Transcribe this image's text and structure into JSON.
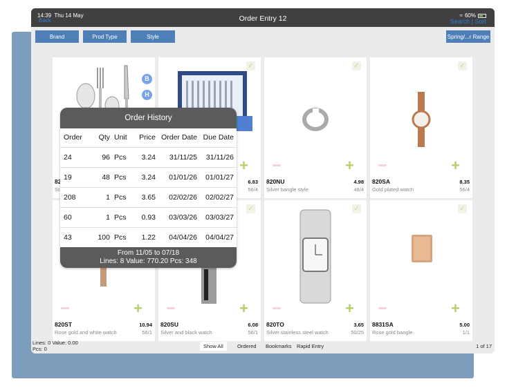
{
  "status": {
    "time": "14:39",
    "date": "Thu 14 May",
    "battery": "60%"
  },
  "nav": {
    "back": "Back",
    "title": "Order Entry 12",
    "search": "Search",
    "sort": "Sort",
    "separator": "|"
  },
  "filters": {
    "brand": "Brand",
    "prod_type": "Prod Type",
    "style": "Style",
    "range": "Spring/...r Range"
  },
  "products": [
    {
      "code": "82",
      "price": "",
      "desc": "St",
      "stock": "",
      "icon": "cutlery-image"
    },
    {
      "code": "",
      "price": "6.83",
      "desc": "",
      "stock": "56/4",
      "icon": "cutlery-box-image"
    },
    {
      "code": "820NU",
      "price": "4.98",
      "desc": "Silver bangle style",
      "stock": "48/4",
      "icon": "bangle-image"
    },
    {
      "code": "820SA",
      "price": "8.35",
      "desc": "Gold plated watch",
      "stock": "56/4",
      "icon": "gold-watch-image"
    },
    {
      "code": "820ST",
      "price": "10.94",
      "desc": "Rose gold and white watch",
      "stock": "56/1",
      "icon": "rose-watch-image"
    },
    {
      "code": "820SU",
      "price": "6.08",
      "desc": "Silver and black watch",
      "stock": "56/1",
      "icon": "black-watch-image"
    },
    {
      "code": "820TO",
      "price": "3.65",
      "desc": "Silver stainless steel watch",
      "stock": "50/25",
      "icon": "steel-watch-image"
    },
    {
      "code": "8831SA",
      "price": "5.00",
      "desc": "Rose gold bangle",
      "stock": "1/1",
      "icon": "rose-bangle-image"
    }
  ],
  "badges": {
    "b": "B",
    "h": "H"
  },
  "order_history": {
    "title": "Order History",
    "headers": [
      "Order",
      "Qty",
      "Unit",
      "Price",
      "Order Date",
      "Due Date"
    ],
    "rows": [
      [
        "24",
        "96",
        "Pcs",
        "3.24",
        "31/11/25",
        "31/11/26"
      ],
      [
        "19",
        "48",
        "Pcs",
        "3.24",
        "01/01/26",
        "01/01/27"
      ],
      [
        "208",
        "1",
        "Pcs",
        "3.65",
        "02/02/26",
        "02/02/27"
      ],
      [
        "60",
        "1",
        "Pcs",
        "0.93",
        "03/03/26",
        "03/03/27"
      ],
      [
        "43",
        "100",
        "Pcs",
        "1.22",
        "04/04/26",
        "04/04/27"
      ]
    ],
    "footer_range": "From 11/05 to 07/18",
    "footer_totals": "Lines: 8 Value: 770.20 Pcs: 348"
  },
  "footer": {
    "summary1": "Lines: 0 Value: 0.00",
    "summary2": "Pcs: 0",
    "tabs": [
      "Show All",
      "Ordered",
      "Bookmarks",
      "Rapid Entry"
    ],
    "pager": "1 of 17"
  },
  "colors": {
    "topbar": "#404040",
    "filter_button": "#4f7fb8",
    "link": "#2f7fd6",
    "plus": "#b7cf6b",
    "popup_header": "#5b5b5b",
    "back_panel": "#7e9dbd"
  }
}
